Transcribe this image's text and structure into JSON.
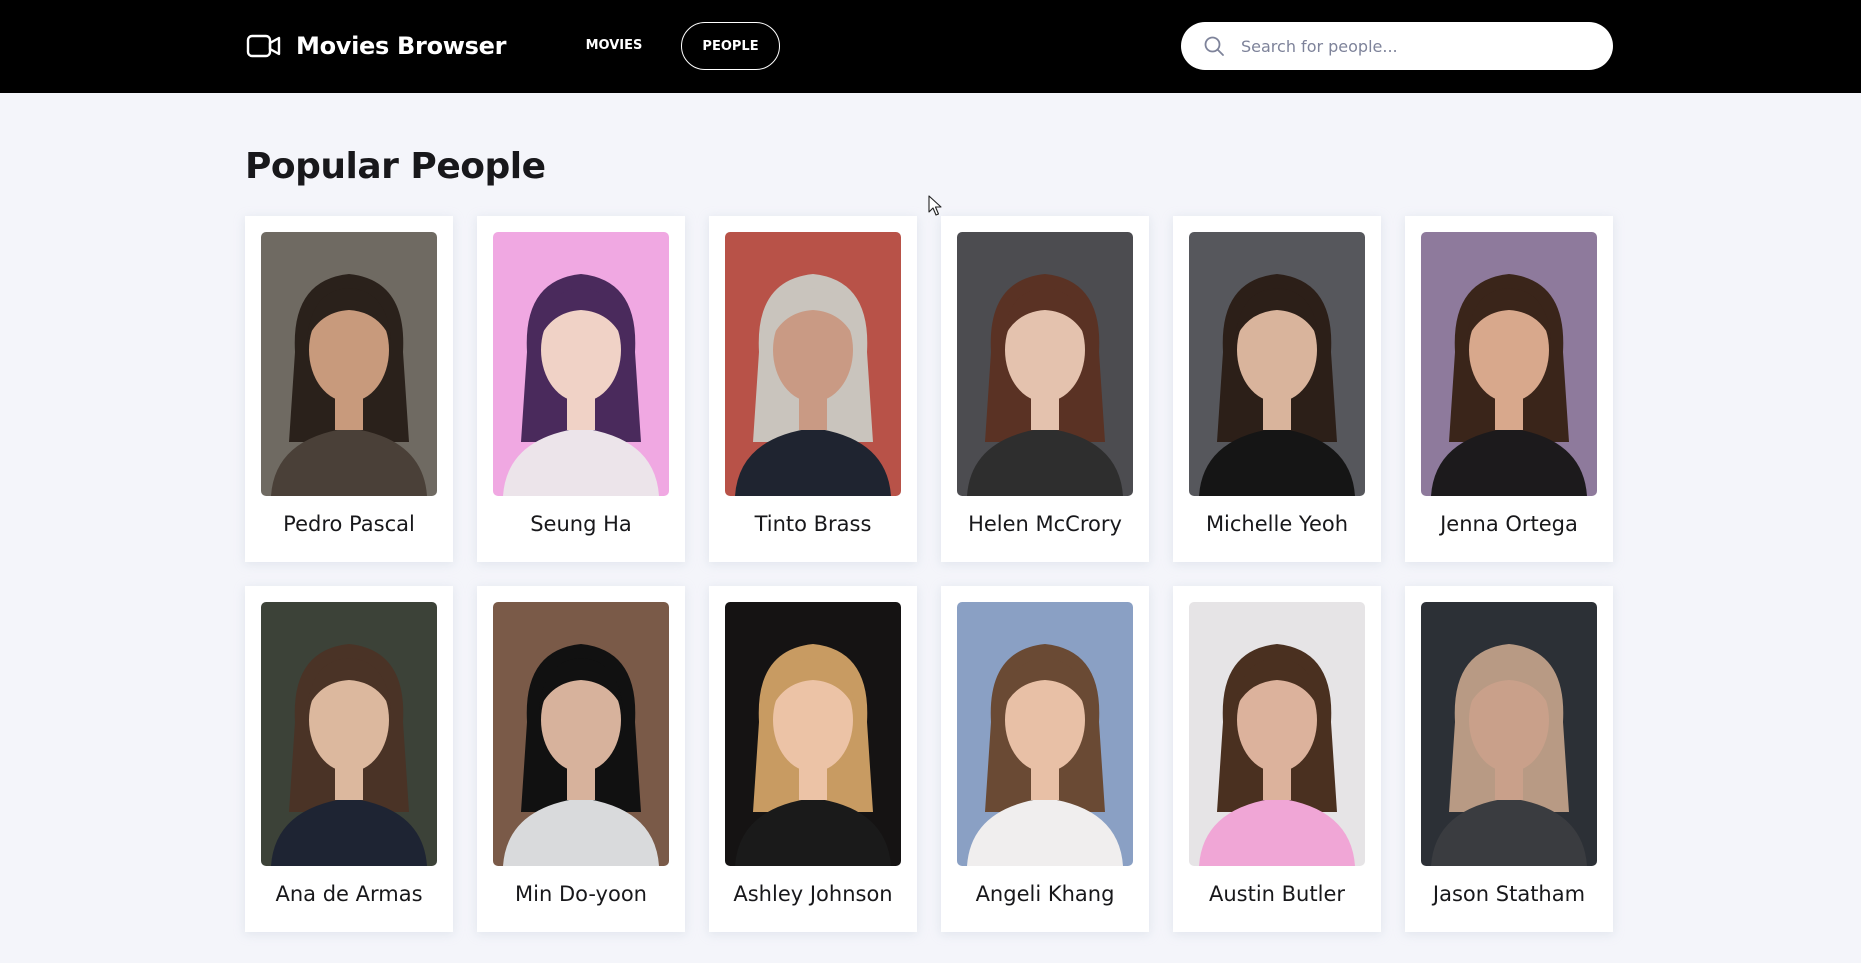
{
  "app": {
    "title": "Movies Browser",
    "logo_icon": "video-camera-icon"
  },
  "nav": {
    "movies_label": "MOVIES",
    "people_label": "PEOPLE",
    "active": "PEOPLE"
  },
  "search": {
    "placeholder": "Search for people...",
    "value": "",
    "icon": "search-icon"
  },
  "page": {
    "title": "Popular People"
  },
  "people": [
    {
      "name": "Pedro Pascal",
      "bg": "#6f6a62",
      "hair": "#2a211b",
      "skin": "#c89a7c",
      "cloth": "#4a4038"
    },
    {
      "name": "Seung Ha",
      "bg": "#f0a8e2",
      "hair": "#4a2a5c",
      "skin": "#f0d2c6",
      "cloth": "#ece4ea"
    },
    {
      "name": "Tinto Brass",
      "bg": "#b85248",
      "hair": "#c9c4bd",
      "skin": "#c99a84",
      "cloth": "#1f2430"
    },
    {
      "name": "Helen McCrory",
      "bg": "#4c4c50",
      "hair": "#5a3224",
      "skin": "#e4c2ae",
      "cloth": "#2e2e2e"
    },
    {
      "name": "Michelle Yeoh",
      "bg": "#56575c",
      "hair": "#2c1f18",
      "skin": "#d9b49c",
      "cloth": "#151515"
    },
    {
      "name": "Jenna Ortega",
      "bg": "#8e7a9c",
      "hair": "#3a251a",
      "skin": "#d8a88c",
      "cloth": "#1c1a1c"
    },
    {
      "name": "Ana de Armas",
      "bg": "#3c4238",
      "hair": "#4a3326",
      "skin": "#dcb89e",
      "cloth": "#1e2433"
    },
    {
      "name": "Min Do-yoon",
      "bg": "#7a5a48",
      "hair": "#111111",
      "skin": "#d7b29c",
      "cloth": "#d9dadc"
    },
    {
      "name": "Ashley Johnson",
      "bg": "#151313",
      "hair": "#c89b62",
      "skin": "#ecc3a6",
      "cloth": "#1a1a1a"
    },
    {
      "name": "Angeli Khang",
      "bg": "#8aa0c4",
      "hair": "#6a4a34",
      "skin": "#e8c0a6",
      "cloth": "#f0eeee"
    },
    {
      "name": "Austin Butler",
      "bg": "#e6e4e6",
      "hair": "#4a3020",
      "skin": "#dcb29c",
      "cloth": "#f0a6d6"
    },
    {
      "name": "Jason Statham",
      "bg": "#2c3036",
      "hair": "#b89a84",
      "skin": "#c9a08a",
      "cloth": "#3a3c40"
    }
  ],
  "colors": {
    "header_bg": "#000000",
    "page_bg": "#f4f5fa",
    "card_bg": "#ffffff",
    "text": "#18181b",
    "placeholder": "#7e839a"
  }
}
